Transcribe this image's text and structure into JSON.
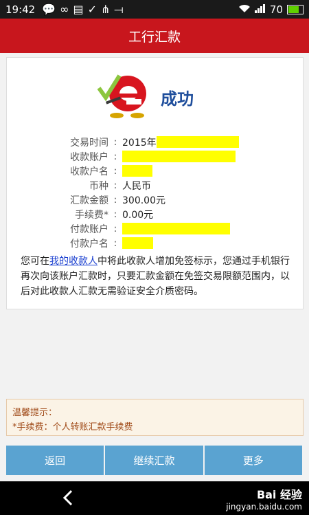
{
  "status_bar": {
    "time": "19:42",
    "icons": [
      "chat-bubble-icon",
      "infinity-icon",
      "message-icon",
      "check-circle-icon",
      "usb-hub-icon",
      "usb-icon"
    ],
    "signal": "wifi+cell",
    "battery": "70"
  },
  "header": {
    "title": "工行汇款"
  },
  "result": {
    "status": "成功",
    "rows": [
      {
        "label": "交易时间",
        "value": "2015年",
        "redacted_width": 120
      },
      {
        "label": "收款账户",
        "value": "",
        "redacted_width": 165
      },
      {
        "label": "收款户名",
        "value": "",
        "redacted_width": 44
      },
      {
        "label": "币种",
        "value": "人民币",
        "redacted_width": 0
      },
      {
        "label": "汇款金额",
        "value": "300.00元",
        "redacted_width": 0
      },
      {
        "label": "手续费*",
        "value": "0.00元",
        "redacted_width": 0
      },
      {
        "label": "付款账户",
        "value": "",
        "redacted_width": 157
      },
      {
        "label": "付款户名",
        "value": "",
        "redacted_width": 45
      }
    ],
    "note_before_link": "您可在",
    "note_link": "我的收款人",
    "note_after_link": "中将此收款人增加免签标示，您通过手机银行再次向该账户汇款时，只要汇款金额在免签交易限额范围内，以后对此收款人汇款无需验证安全介质密码。"
  },
  "tips": {
    "title": "温馨提示：",
    "line1": "*手续费：个人转账汇款手续费"
  },
  "buttons": {
    "back": "返回",
    "continue": "继续汇款",
    "more": "更多"
  },
  "watermark": {
    "brand": "Bai 经验",
    "url": "jingyan.baidu.com"
  },
  "colors": {
    "header_red": "#c8161d",
    "button_blue": "#5aa3d1",
    "link_blue": "#1a3fd0",
    "highlight": "#ffff00"
  }
}
